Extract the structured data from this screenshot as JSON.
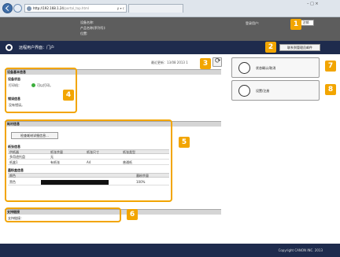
{
  "browser": {
    "url_host": "http://192.168.1.24",
    "url_path": "/portal_top.html",
    "address_tools": "ρ ▾ c",
    "tab_title": "",
    "window_controls": "– □ ×"
  },
  "header": {
    "device_name_label": "设备名称:",
    "device_name_value": "",
    "product_name_label": "产品名称(序列号):",
    "product_name_value": "",
    "location_label": "位置:",
    "login_user_label": "登录用户:",
    "login_user_value": "",
    "logout_label": "注销"
  },
  "titlebar": {
    "title": "远程用户界面：门户",
    "admin_mail_label": "联系到管理员邮件"
  },
  "status": {
    "last_updated_label": "最近更新：",
    "last_updated_value": "13/08 2013 1"
  },
  "device_info": {
    "section_title": "设备基本信息",
    "device_status_title": "设备状态",
    "printer_label": "打印机：",
    "printer_status": "可以打印。",
    "error_title": "错误信息",
    "error_value": "没有错误。"
  },
  "consumables": {
    "section_title": "耗材信息",
    "check_button_label": "检查耗材详细信息...",
    "paper_title": "纸张信息",
    "paper_columns": [
      "供纸器",
      "纸张余量",
      "纸张尺寸",
      "纸张类型"
    ],
    "paper_rows": [
      [
        "多用途托盘",
        "无",
        "",
        ""
      ],
      [
        "纸盒1",
        "有纸张",
        "A4",
        "普通纸"
      ]
    ],
    "cartridge_title": "墨粉盒信息",
    "cartridge_columns": [
      "颜色",
      "",
      "墨粉余量"
    ],
    "cartridge_rows": [
      {
        "color": "黑色",
        "level_label": "100%",
        "level": 1.0
      }
    ]
  },
  "support": {
    "section_title": "支持链接",
    "link_label": "支持链接："
  },
  "sidebar": {
    "status_button_label": "状态确认/取消",
    "settings_button_label": "设置/注册"
  },
  "callouts": [
    "1",
    "2",
    "3",
    "4",
    "5",
    "6",
    "7",
    "8"
  ],
  "footer": {
    "copyright": "Copyright CANON INC. 2013"
  },
  "colors": {
    "accent": "#f2a500",
    "titlebar": "#1e2b4d",
    "header": "#5d5d5d",
    "status_ok": "#3cae3c"
  }
}
